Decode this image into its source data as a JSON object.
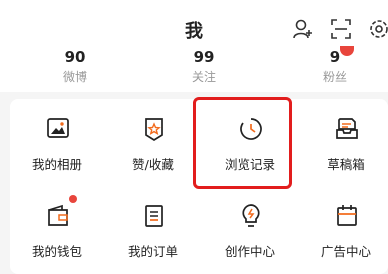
{
  "header": {
    "title": "我",
    "icons": [
      "add-user-icon",
      "scan-icon",
      "settings-icon"
    ]
  },
  "stats": [
    {
      "value": "90",
      "label": "微博"
    },
    {
      "value": "99",
      "label": "关注"
    },
    {
      "value": "9",
      "label": "粉丝"
    }
  ],
  "grid": [
    {
      "label": "我的相册",
      "icon": "photo-album-icon"
    },
    {
      "label": "赞/收藏",
      "icon": "star-badge-icon"
    },
    {
      "label": "浏览记录",
      "icon": "history-clock-icon"
    },
    {
      "label": "草稿箱",
      "icon": "drafts-tray-icon"
    },
    {
      "label": "我的钱包",
      "icon": "wallet-icon"
    },
    {
      "label": "我的订单",
      "icon": "order-list-icon"
    },
    {
      "label": "创作中心",
      "icon": "creator-bulb-icon"
    },
    {
      "label": "广告中心",
      "icon": "ad-calendar-icon"
    }
  ],
  "colors": {
    "accent": "#e8453c",
    "highlight": "#e21d1d",
    "icon_orange": "#f26b1d"
  }
}
